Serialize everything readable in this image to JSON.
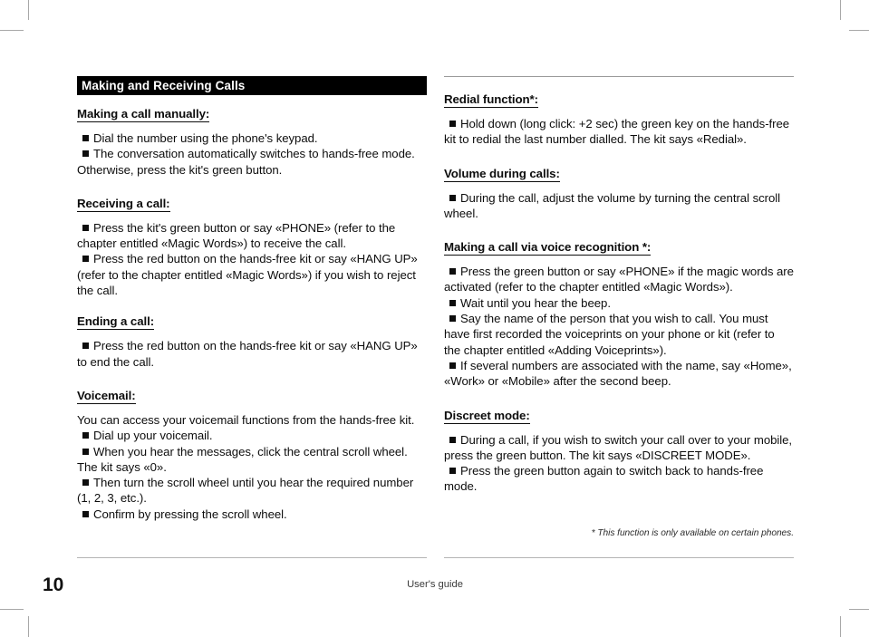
{
  "document": {
    "banner_title": "Making and Receiving Calls",
    "page_number": "10",
    "footer_label": "User's guide",
    "footnote": "* This function is only available on certain phones."
  },
  "left_column": {
    "sections": [
      {
        "heading": "Making a call manually:",
        "bullets": [
          "Dial the number using the phone's keypad.",
          "The conversation automatically switches to hands-free mode. Otherwise, press the kit's green button."
        ]
      },
      {
        "heading": "Receiving a call: ",
        "bullets": [
          "Press the kit's green button or say «PHONE» (refer to the chapter entitled «Magic Words») to receive the call.",
          "Press the red button on the hands-free kit or say «HANG UP» (refer to the chapter entitled «Magic Words») if you wish to reject the call."
        ]
      },
      {
        "heading": "Ending a call: ",
        "bullets": [
          "Press the red button on the hands-free kit or say «HANG UP» to end the call."
        ]
      },
      {
        "heading": "Voicemail:",
        "intro": "You can access your voicemail functions from the hands-free kit.",
        "bullets": [
          "Dial up your voicemail.",
          "When you hear the messages, click the central scroll wheel. The kit says «0».",
          "Then turn the scroll wheel until you hear the required number (1, 2, 3, etc.).",
          "Confirm by pressing the scroll wheel."
        ]
      }
    ]
  },
  "right_column": {
    "sections": [
      {
        "heading": "Redial function*: ",
        "bullets": [
          "Hold down (long click: +2 sec) the green key on the hands-free kit to redial the last number dialled. The kit says «Redial»."
        ]
      },
      {
        "heading": "Volume during calls: ",
        "bullets": [
          "During the call, adjust the volume by turning the central scroll wheel."
        ]
      },
      {
        "heading": "Making a call via voice recognition *: ",
        "bullets": [
          "Press the green button or say «PHONE» if the magic words are activated (refer to the chapter entitled «Magic Words»).",
          "Wait until you hear the beep.",
          "Say the name of the person that you wish to call. You must have first recorded the voiceprints on your phone or kit (refer to the chapter entitled «Adding Voiceprints»).",
          "If several numbers are associated with the name, say «Home»,  «Work» or «Mobile» after the second beep."
        ]
      },
      {
        "heading": "Discreet mode: ",
        "bullets": [
          "During a call, if you wish to switch your call over to your mobile, press the green button. The kit says «DISCREET MODE».",
          "Press the green button again to switch back to hands-free mode."
        ]
      }
    ]
  }
}
